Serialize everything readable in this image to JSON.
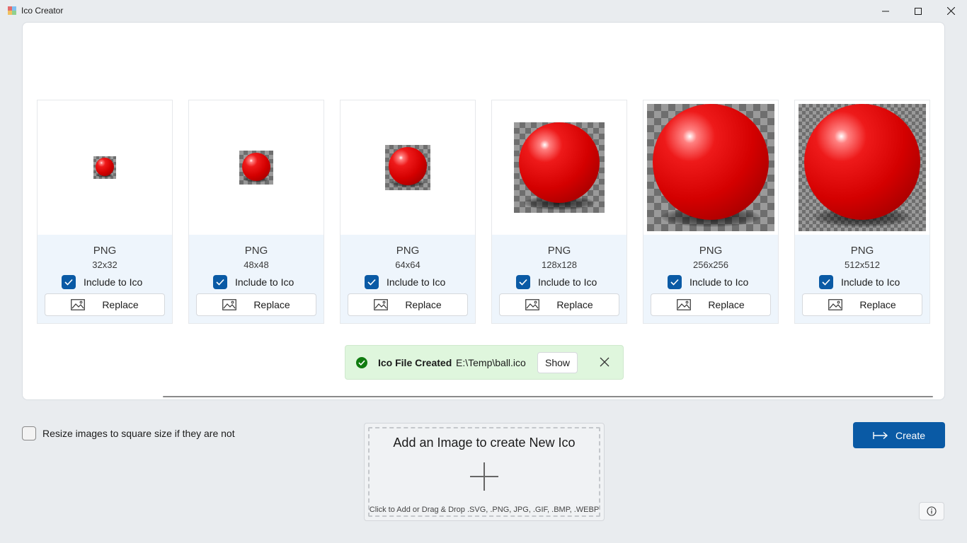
{
  "window": {
    "title": "Ico Creator",
    "minimize_glyph": "—",
    "maximize_glyph": "☐",
    "close_glyph": "✕"
  },
  "images": [
    {
      "format": "PNG",
      "size": "32x32",
      "include_label": "Include to Ico",
      "replace_label": "Replace",
      "included": true
    },
    {
      "format": "PNG",
      "size": "48x48",
      "include_label": "Include to Ico",
      "replace_label": "Replace",
      "included": true
    },
    {
      "format": "PNG",
      "size": "64x64",
      "include_label": "Include to Ico",
      "replace_label": "Replace",
      "included": true
    },
    {
      "format": "PNG",
      "size": "128x128",
      "include_label": "Include to Ico",
      "replace_label": "Replace",
      "included": true
    },
    {
      "format": "PNG",
      "size": "256x256",
      "include_label": "Include to Ico",
      "replace_label": "Replace",
      "included": true
    },
    {
      "format": "PNG",
      "size": "512x512",
      "include_label": "Include to Ico",
      "replace_label": "Replace",
      "included": true
    }
  ],
  "notification": {
    "title": "Ico File Created",
    "path": "E:\\Temp\\ball.ico",
    "show_label": "Show"
  },
  "options": {
    "resize_label": "Resize images to square size if they are not",
    "resize_checked": false
  },
  "dropzone": {
    "title": "Add an Image to create New Ico",
    "hint": "Click to Add or Drag & Drop .SVG, .PNG, JPG, .GIF, .BMP, .WEBP"
  },
  "actions": {
    "create_label": "Create"
  },
  "colors": {
    "accent": "#0a5aa5",
    "success_bg": "#dff6dd",
    "success_icon": "#107c10",
    "card_info_bg": "#eef5fc"
  }
}
